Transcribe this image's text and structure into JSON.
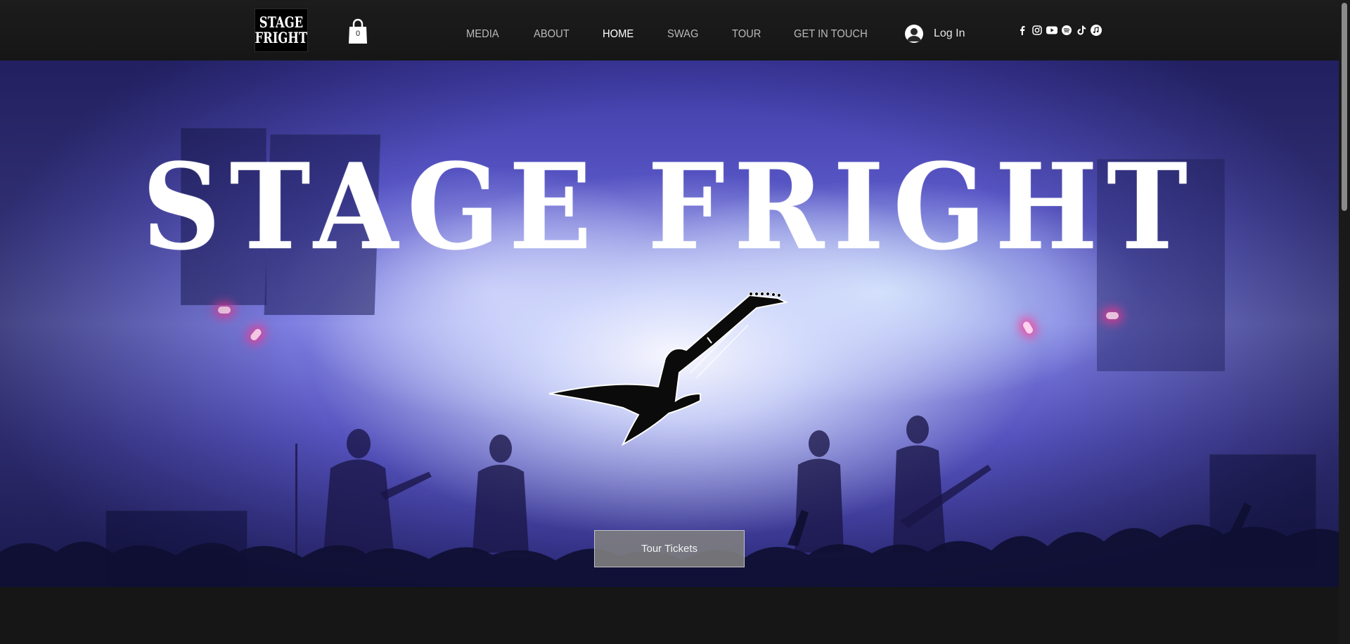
{
  "header": {
    "logo": {
      "line1": "STAGE",
      "line2": "FRIGHT"
    },
    "cart": {
      "count": "0",
      "icon": "shopping-bag-icon"
    },
    "nav": [
      {
        "label": "MEDIA",
        "active": false
      },
      {
        "label": "ABOUT",
        "active": false
      },
      {
        "label": "HOME",
        "active": true
      },
      {
        "label": "SWAG",
        "active": false
      },
      {
        "label": "TOUR",
        "active": false
      },
      {
        "label": "GET IN TOUCH",
        "active": false
      }
    ],
    "login": {
      "label": "Log In",
      "icon": "user-avatar-icon"
    },
    "social": [
      "facebook-icon",
      "instagram-icon",
      "youtube-icon",
      "spotify-icon",
      "tiktok-icon",
      "apple-music-icon"
    ]
  },
  "hero": {
    "title": "STAGE FRIGHT",
    "cta_label": "Tour Tickets"
  },
  "colors": {
    "header_bg": "#1a1a1a",
    "nav_text": "#b9b9b9",
    "nav_active": "#ffffff",
    "cta_bg": "#808080",
    "hero_tint": "#5b59c9"
  }
}
